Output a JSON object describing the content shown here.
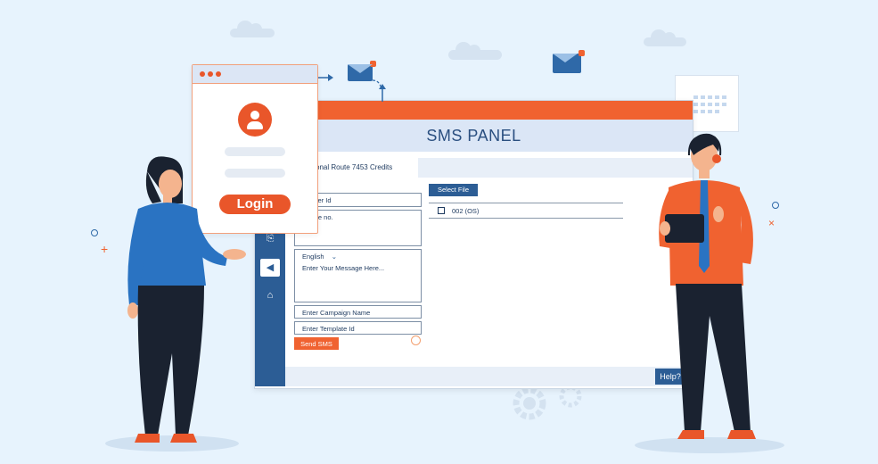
{
  "panel": {
    "title": "SMS PANEL",
    "credits_label": "ctional Route 7453 Credits",
    "fields": {
      "sender_id_placeholder": "Sender Id",
      "mobile_placeholder": "Mobile no.",
      "language": "English",
      "message_placeholder": "Enter Your Message Here...",
      "campaign_placeholder": "Enter Campaign Name",
      "template_placeholder": "Enter Template Id"
    },
    "send_label": "Send SMS",
    "select_file_label": "Select File",
    "file_item": "002 (OS)",
    "help_label": "Help?"
  },
  "login": {
    "button_label": "Login"
  },
  "colors": {
    "accent": "#f06230",
    "primary": "#2c5d95",
    "background": "#e7f3fd"
  }
}
